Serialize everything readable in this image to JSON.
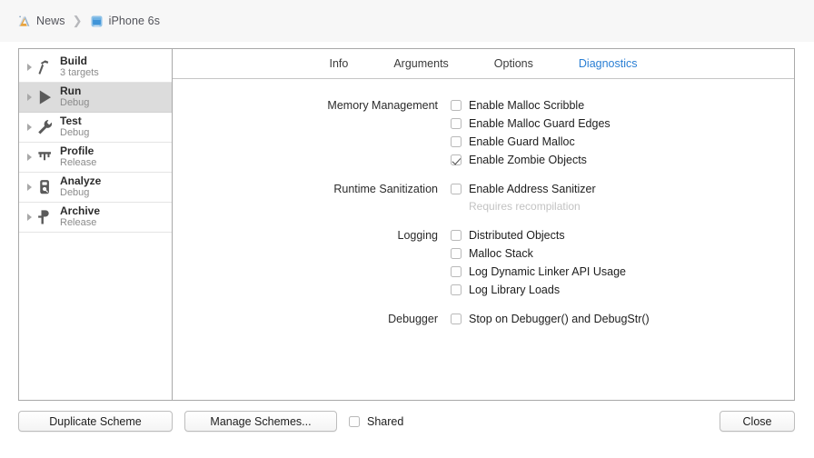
{
  "breadcrumb": {
    "scheme_icon": "xcode-app-icon",
    "scheme_label": "News",
    "separator": "❯",
    "destination_icon": "iphone-simulator-icon",
    "destination_label": "iPhone 6s"
  },
  "sidebar": {
    "items": [
      {
        "icon": "hammer-icon",
        "title": "Build",
        "subtitle": "3 targets",
        "selected": false
      },
      {
        "icon": "play-icon",
        "title": "Run",
        "subtitle": "Debug",
        "selected": true
      },
      {
        "icon": "wrench-icon",
        "title": "Test",
        "subtitle": "Debug",
        "selected": false
      },
      {
        "icon": "gauge-icon",
        "title": "Profile",
        "subtitle": "Release",
        "selected": false
      },
      {
        "icon": "analyze-icon",
        "title": "Analyze",
        "subtitle": "Debug",
        "selected": false
      },
      {
        "icon": "archive-icon",
        "title": "Archive",
        "subtitle": "Release",
        "selected": false
      }
    ]
  },
  "tabs": [
    {
      "label": "Info",
      "active": false
    },
    {
      "label": "Arguments",
      "active": false
    },
    {
      "label": "Options",
      "active": false
    },
    {
      "label": "Diagnostics",
      "active": true
    }
  ],
  "groups": [
    {
      "label": "Memory Management",
      "options": [
        {
          "label": "Enable Malloc Scribble",
          "checked": false
        },
        {
          "label": "Enable Malloc Guard Edges",
          "checked": false
        },
        {
          "label": "Enable Guard Malloc",
          "checked": false
        },
        {
          "label": "Enable Zombie Objects",
          "checked": true
        }
      ],
      "note": ""
    },
    {
      "label": "Runtime Sanitization",
      "options": [
        {
          "label": "Enable Address Sanitizer",
          "checked": false
        }
      ],
      "note": "Requires recompilation"
    },
    {
      "label": "Logging",
      "options": [
        {
          "label": "Distributed Objects",
          "checked": false
        },
        {
          "label": "Malloc Stack",
          "checked": false
        },
        {
          "label": "Log Dynamic Linker API Usage",
          "checked": false
        },
        {
          "label": "Log Library Loads",
          "checked": false
        }
      ],
      "note": ""
    },
    {
      "label": "Debugger",
      "options": [
        {
          "label": "Stop on Debugger() and DebugStr()",
          "checked": false
        }
      ],
      "note": ""
    }
  ],
  "footer": {
    "duplicate_scheme": "Duplicate Scheme",
    "manage_schemes": "Manage Schemes...",
    "shared_label": "Shared",
    "shared_checked": false,
    "close": "Close"
  },
  "colors": {
    "accent": "#2a7fd4",
    "selected_row": "#dcdcdc",
    "panel_border": "#a9a9a9",
    "titlebar": "#f7f7f7"
  }
}
